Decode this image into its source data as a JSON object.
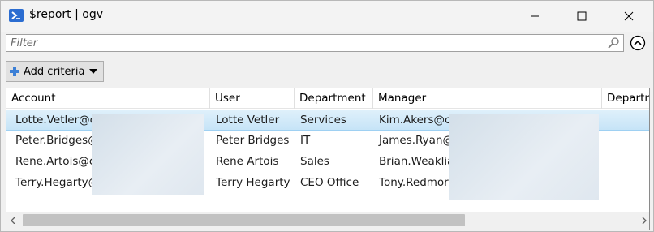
{
  "window": {
    "title": "$report | ogv"
  },
  "filter": {
    "placeholder": "Filter",
    "value": ""
  },
  "toolbar": {
    "add_criteria_label": "Add criteria"
  },
  "grid": {
    "columns": [
      "Account",
      "User",
      "Department",
      "Manager",
      "Departm"
    ],
    "rows": [
      {
        "account": "Lotte.Vetler@c",
        "user": "Lotte Vetler",
        "department": "Services",
        "manager": "Kim.Akers@c",
        "selected": true
      },
      {
        "account": "Peter.Bridges@",
        "user": "Peter Bridges",
        "department": "IT",
        "manager": "James.Ryan@",
        "selected": false
      },
      {
        "account": "Rene.Artois@c",
        "user": "Rene Artois",
        "department": "Sales",
        "manager": "Brian.Weaklia",
        "selected": false
      },
      {
        "account": "Terry.Hegarty@",
        "user": "Terry Hegarty",
        "department": "CEO Office",
        "manager": "Tony.Redmor",
        "selected": false
      }
    ]
  },
  "colors": {
    "selection": "#cce8f8",
    "icon_blue": "#2b6dd1"
  },
  "icons": {
    "app": "powershell-icon",
    "search": "search-icon",
    "collapse": "chevron-up-circle-icon",
    "add": "plus-icon",
    "dropdown": "triangle-down-icon"
  }
}
